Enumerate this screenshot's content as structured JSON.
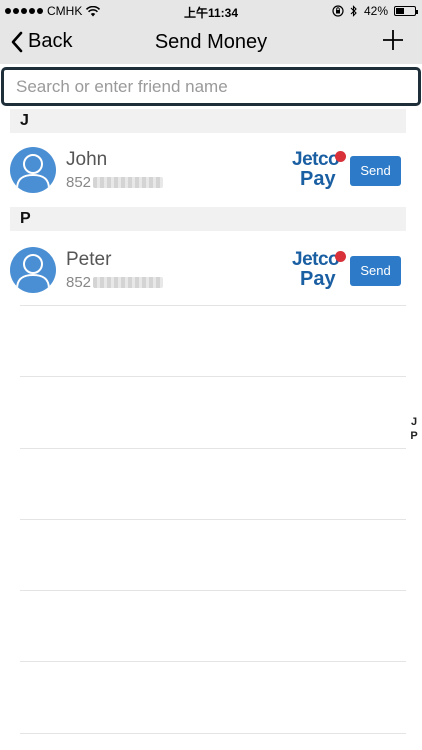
{
  "status_bar": {
    "carrier": "CMHK",
    "time": "上午11:34",
    "battery_text": "42%"
  },
  "nav": {
    "back_label": "Back",
    "title": "Send Money"
  },
  "search": {
    "placeholder": "Search or enter friend name"
  },
  "sections": [
    {
      "letter": "J",
      "contacts": [
        {
          "name": "John",
          "phone_prefix": "852",
          "provider_top": "Jetco",
          "provider_bottom": "Pay",
          "send_label": "Send"
        }
      ]
    },
    {
      "letter": "P",
      "contacts": [
        {
          "name": "Peter",
          "phone_prefix": "852",
          "provider_top": "Jetco",
          "provider_bottom": "Pay",
          "send_label": "Send"
        }
      ]
    }
  ],
  "index_letters": [
    "J",
    "P"
  ],
  "colors": {
    "bar_bg": "#e6e6e6",
    "avatar_blue": "#4a8fd3",
    "send_blue": "#2d7bc8",
    "jetco_blue": "#1b5fa3",
    "jetco_red": "#d8313a"
  },
  "icons": [
    "chevron-left-icon",
    "plus-icon",
    "wifi-icon",
    "bluetooth-icon",
    "lock-rotation-icon",
    "battery-icon",
    "person-icon"
  ]
}
